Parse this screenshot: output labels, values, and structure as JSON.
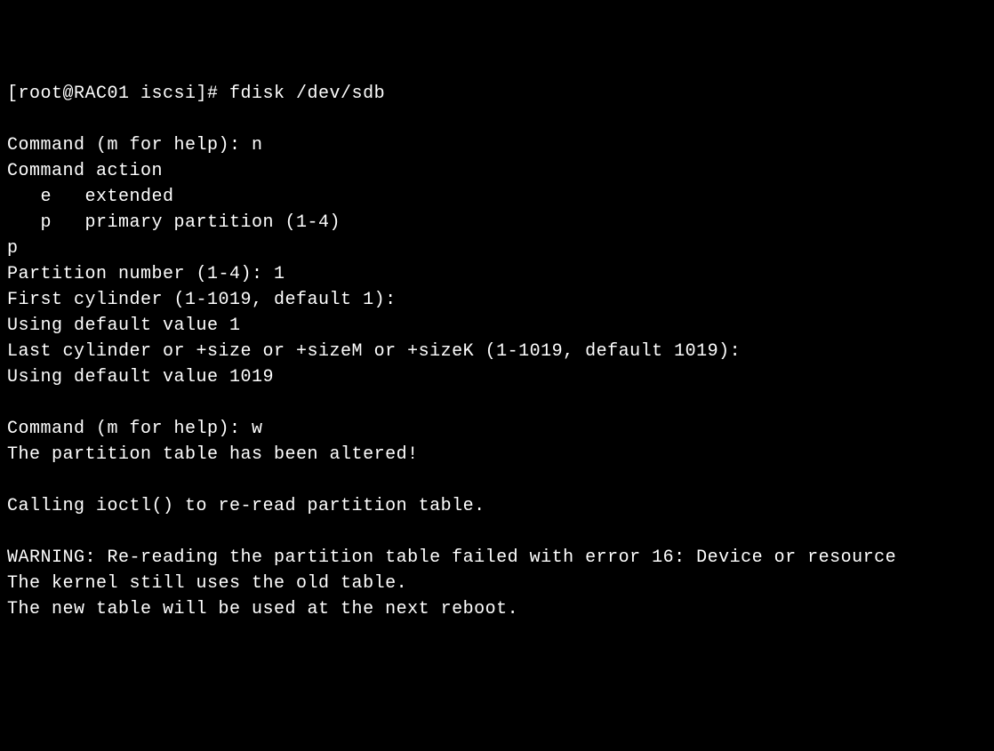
{
  "terminal": {
    "lines": [
      "[root@RAC01 iscsi]# fdisk /dev/sdb",
      "",
      "Command (m for help): n",
      "Command action",
      "   e   extended",
      "   p   primary partition (1-4)",
      "p",
      "Partition number (1-4): 1",
      "First cylinder (1-1019, default 1):",
      "Using default value 1",
      "Last cylinder or +size or +sizeM or +sizeK (1-1019, default 1019):",
      "Using default value 1019",
      "",
      "Command (m for help): w",
      "The partition table has been altered!",
      "",
      "Calling ioctl() to re-read partition table.",
      "",
      "WARNING: Re-reading the partition table failed with error 16: Device or resource",
      "The kernel still uses the old table.",
      "The new table will be used at the next reboot."
    ]
  }
}
